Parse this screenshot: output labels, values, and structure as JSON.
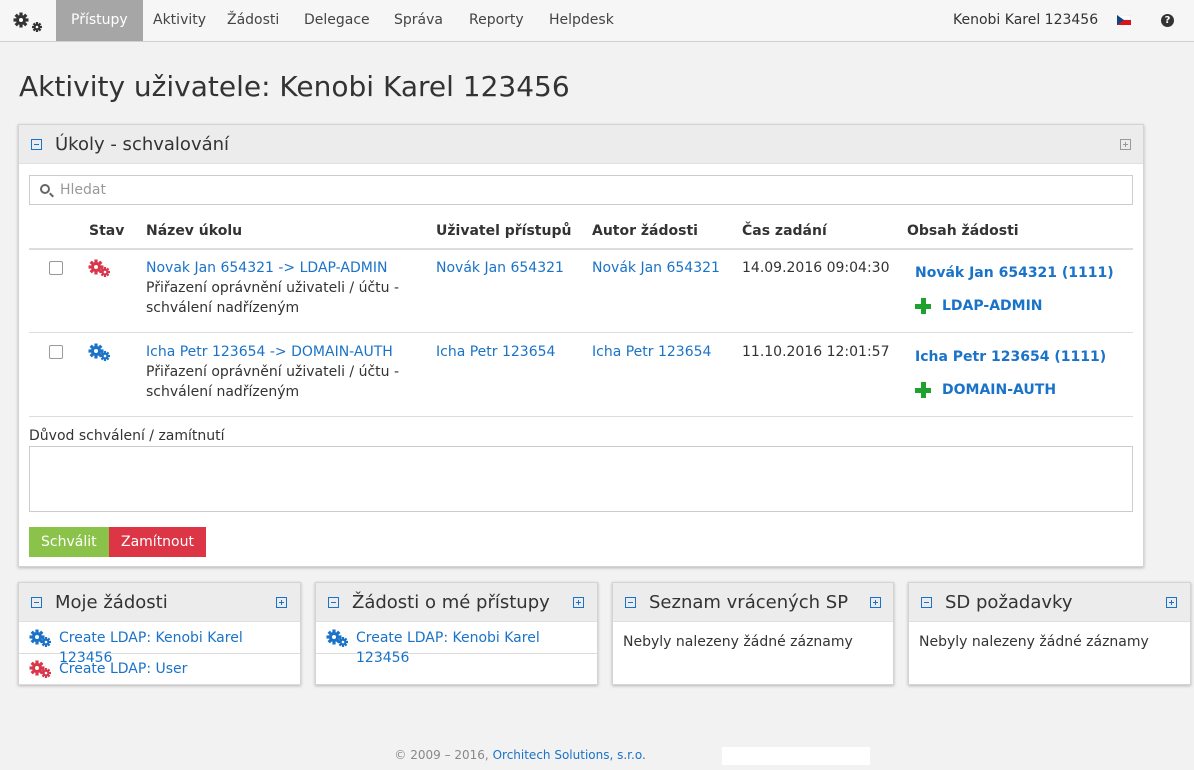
{
  "nav": {
    "items": [
      "Přístupy",
      "Aktivity",
      "Žádosti",
      "Delegace",
      "Správa",
      "Reporty",
      "Helpdesk"
    ],
    "user": "Kenobi Karel 123456",
    "help": "?"
  },
  "page_title": "Aktivity uživatele: Kenobi Karel 123456",
  "tasks_panel": {
    "title": "Úkoly - schvalování",
    "search_placeholder": "Hledat",
    "columns": [
      "Stav",
      "Název úkolu",
      "Uživatel přístupů",
      "Autor žádosti",
      "Čas zadání",
      "Obsah žádosti"
    ],
    "rows": [
      {
        "status_icon": "gears-red-icon",
        "task_link": "Novak Jan 654321 -> LDAP-ADMIN",
        "task_desc": "Přiřazení oprávnění uživateli / účtu - schválení nadřízeným",
        "user": "Novák Jan 654321",
        "author": "Novák Jan 654321",
        "time": "14.09.2016 09:04:30",
        "content_user": "Novák Jan 654321 (1111)",
        "content_role": "LDAP-ADMIN"
      },
      {
        "status_icon": "gears-blue-icon",
        "task_link": "Icha Petr 123654 -> DOMAIN-AUTH",
        "task_desc": "Přiřazení oprávnění uživateli / účtu - schválení nadřízeným",
        "user": "Icha Petr 123654",
        "author": "Icha Petr 123654",
        "time": "11.10.2016 12:01:57",
        "content_user": "Icha Petr 123654 (1111)",
        "content_role": "DOMAIN-AUTH"
      }
    ],
    "reason_label": "Důvod schválení / zamítnutí",
    "approve_label": "Schválit",
    "reject_label": "Zamítnout"
  },
  "my_requests": {
    "title": "Moje žádosti",
    "items": [
      {
        "label": "Create LDAP: Kenobi Karel 123456",
        "icon": "gears-blue-icon"
      },
      {
        "label": "Create LDAP: User",
        "icon": "gears-red-icon"
      }
    ]
  },
  "access_requests": {
    "title": "Žádosti o mé přístupy",
    "items": [
      {
        "label": "Create LDAP: Kenobi Karel 123456",
        "icon": "gears-blue-icon"
      }
    ]
  },
  "returned_sp": {
    "title": "Seznam vrácených SP",
    "empty": "Nebyly nalezeny žádné záznamy"
  },
  "sd_requests": {
    "title": "SD požadavky",
    "empty": "Nebyly nalezeny žádné záznamy"
  },
  "footer": {
    "copyright": "© 2009 – 2016,",
    "company": "Orchitech Solutions, s.r.o."
  },
  "colors": {
    "link": "#1a73c8",
    "active_nav": "#a6a6a6",
    "approve": "#8bc34a",
    "reject": "#dc3545",
    "gear_red": "#d9364a",
    "gear_blue": "#1a73c8",
    "plus_green": "#1fa12f"
  }
}
